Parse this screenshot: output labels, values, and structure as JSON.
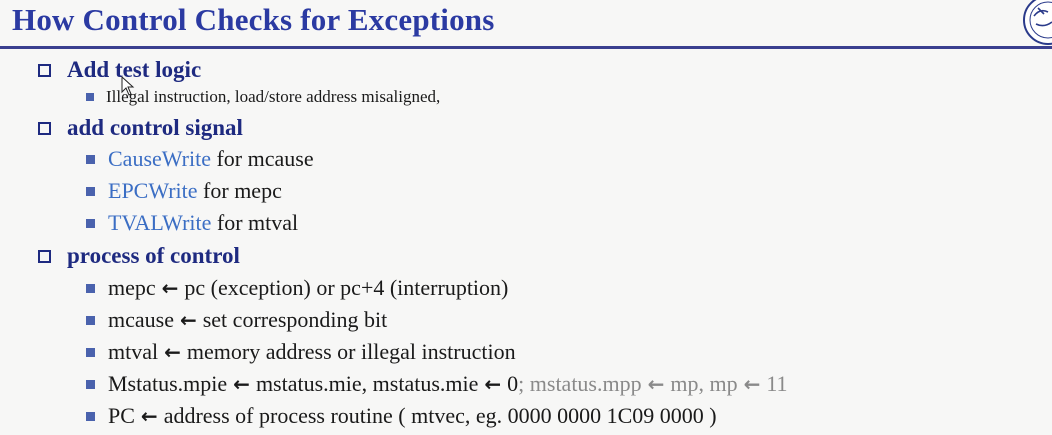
{
  "slide": {
    "title": "How Control Checks for Exceptions"
  },
  "sections": [
    {
      "heading": "Add test logic",
      "items": [
        {
          "text": "Illegal instruction, load/store address misaligned,"
        }
      ]
    },
    {
      "heading": "add control signal",
      "items": [
        {
          "signal": "CauseWrite",
          "rest": " for mcause"
        },
        {
          "signal": "EPCWrite",
          "rest": " for mepc"
        },
        {
          "signal": "TVALWrite",
          "rest": " for mtval"
        }
      ]
    },
    {
      "heading": "process of control",
      "items": [
        {
          "lhs": "mepc",
          "rhs": "pc (exception) or pc+4 (interruption)"
        },
        {
          "lhs": "mcause",
          "rhs": "set corresponding bit"
        },
        {
          "lhs": "mtval",
          "rhs": "memory address or illegal instruction"
        },
        {
          "lhs": "Mstatus.mpie",
          "rhs_a": "mstatus.mie, mstatus.mie",
          "rhs_b": "0",
          "sep": ";",
          "gray_lhs": " mstatus.mpp",
          "gray_mid": "mp, mp",
          "gray_end": "11"
        },
        {
          "lhs": "PC",
          "rhs": "address of process routine ( mtvec, eg. 0000 0000 1C09 0000 )"
        }
      ]
    }
  ],
  "arrow_glyph": "←",
  "colors": {
    "title": "#2b3aa2",
    "heading": "#1e2a80",
    "signal": "#3b6ec4",
    "muted": "#8a8a8a",
    "bullet": "#4a62ad"
  },
  "icons": {
    "logo": "university-seal-icon",
    "cursor": "mouse-pointer-icon"
  }
}
